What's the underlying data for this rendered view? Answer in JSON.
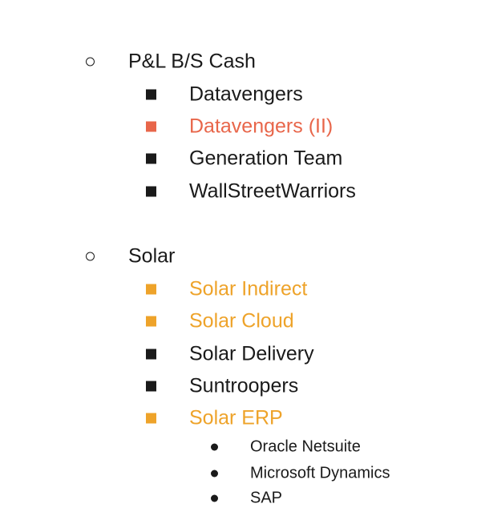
{
  "colors": {
    "text": "#1a1a1a",
    "red_highlight": "#e8664a",
    "orange_highlight": "#eea32a"
  },
  "sections": [
    {
      "label": "P&L B/S Cash",
      "items": [
        {
          "label": "Datavengers",
          "color": "#1a1a1a"
        },
        {
          "label": "Datavengers (II)",
          "color": "#e8664a"
        },
        {
          "label": "Generation Team",
          "color": "#1a1a1a"
        },
        {
          "label": "WallStreetWarriors",
          "color": "#1a1a1a"
        }
      ]
    },
    {
      "label": "Solar",
      "items": [
        {
          "label": "Solar Indirect",
          "color": "#eea32a"
        },
        {
          "label": "Solar Cloud",
          "color": "#eea32a"
        },
        {
          "label": "Solar Delivery",
          "color": "#1a1a1a"
        },
        {
          "label": "Suntroopers",
          "color": "#1a1a1a"
        },
        {
          "label": "Solar ERP",
          "color": "#eea32a",
          "subitems": [
            {
              "label": "Oracle Netsuite"
            },
            {
              "label": "Microsoft Dynamics"
            },
            {
              "label": "SAP"
            }
          ]
        }
      ]
    }
  ]
}
